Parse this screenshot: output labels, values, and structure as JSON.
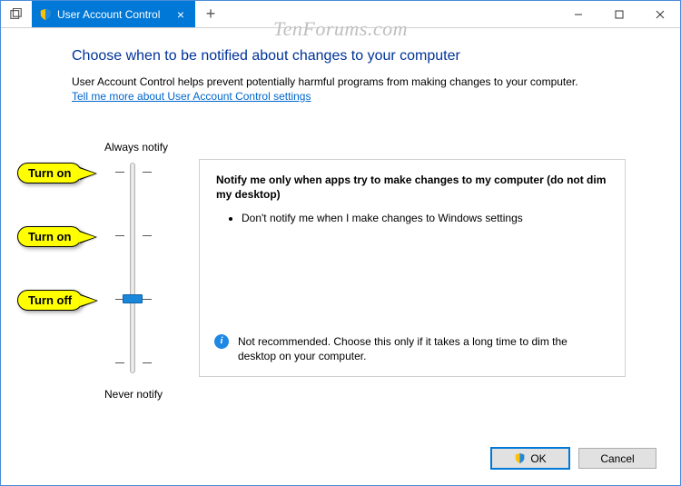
{
  "tab": {
    "title": "User Account Control"
  },
  "watermark": "TenForums.com",
  "page": {
    "heading": "Choose when to be notified about changes to your computer",
    "description": "User Account Control helps prevent potentially harmful programs from making changes to your computer.",
    "help_link": "Tell me more about User Account Control settings"
  },
  "slider": {
    "top_label": "Always notify",
    "bottom_label": "Never notify",
    "levels": 4,
    "selected_index": 2
  },
  "panel": {
    "heading": "Notify me only when apps try to make changes to my computer (do not dim my desktop)",
    "bullets": [
      "Don't notify me when I make changes to Windows settings"
    ],
    "note": "Not recommended. Choose this only if it takes a long time to dim the desktop on your computer."
  },
  "callouts": [
    {
      "label": "Turn on",
      "slider_index": 0
    },
    {
      "label": "Turn on",
      "slider_index": 1
    },
    {
      "label": "Turn off",
      "slider_index": 2
    }
  ],
  "buttons": {
    "ok": "OK",
    "cancel": "Cancel"
  }
}
